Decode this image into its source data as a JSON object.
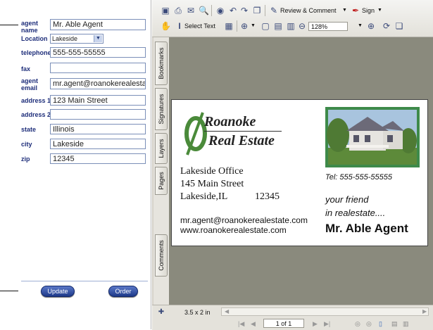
{
  "form": {
    "fields": [
      {
        "label_line1": "agent",
        "label_line2": "name",
        "value": "Mr. Able Agent"
      },
      {
        "label": "Location",
        "selected": "Lakeside"
      },
      {
        "label": "telephone",
        "value": "555-555-55555"
      },
      {
        "label": "fax",
        "value": ""
      },
      {
        "label_line1": "agent",
        "label_line2": "email",
        "value": "mr.agent@roanokerealesta"
      },
      {
        "label": "address 1",
        "value": "123 Main Street"
      },
      {
        "label": "address 2",
        "value": ""
      },
      {
        "label": "state",
        "value": "Illinois"
      },
      {
        "label": "city",
        "value": "Lakeside"
      },
      {
        "label": "zip",
        "value": "12345"
      }
    ],
    "update_label": "Update",
    "order_label": "Order"
  },
  "toolbar": {
    "review_label": "Review & Comment",
    "sign_label": "Sign",
    "select_text_label": "Select Text",
    "zoom_value": "128%"
  },
  "side_tabs": [
    "Bookmarks",
    "Signatures",
    "Layers",
    "Pages",
    "Comments"
  ],
  "card": {
    "company_line1": "Roanoke",
    "company_line2": "Real Estate",
    "office_name": "Lakeside Office",
    "street": "145 Main Street",
    "city_state": "Lakeside,IL",
    "zip": "12345",
    "email": "mr.agent@roanokerealestate.com",
    "website": "www.roanokerealestate.com",
    "tel": "Tel:  555-555-55555",
    "tagline1": "your friend",
    "tagline2": "in realestate....",
    "agent_name": "Mr. Able Agent"
  },
  "statusbar": {
    "page_size": "3.5 x 2 in",
    "page_indicator": "1 of 1"
  },
  "colors": {
    "label_blue": "#1e2e7a",
    "doc_background": "#8a8a7d",
    "logo_green": "#4a8a3a"
  }
}
